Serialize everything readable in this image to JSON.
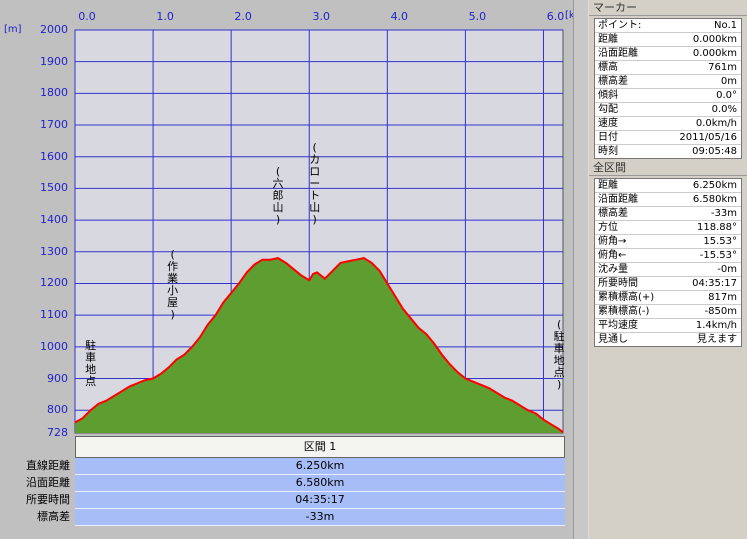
{
  "chart_data": {
    "type": "area",
    "xlabel_unit": "[km]",
    "ylabel_unit": "[m]",
    "xlim": [
      0,
      6.25
    ],
    "ylim": [
      728,
      2000
    ],
    "x_ticks": [
      "0.0",
      "1.0",
      "2.0",
      "3.0",
      "4.0",
      "5.0",
      "6.0"
    ],
    "y_ticks": [
      "2000",
      "1900",
      "1800",
      "1700",
      "1600",
      "1500",
      "1400",
      "1300",
      "1200",
      "1100",
      "1000",
      "900",
      "800",
      "728"
    ],
    "grid": true,
    "series": [
      {
        "values_x": [
          0.0,
          0.1,
          0.2,
          0.3,
          0.4,
          0.5,
          0.6,
          0.7,
          0.8,
          0.9,
          1.0,
          1.1,
          1.2,
          1.3,
          1.4,
          1.5,
          1.6,
          1.7,
          1.8,
          1.9,
          2.0,
          2.1,
          2.2,
          2.3,
          2.4,
          2.5,
          2.6,
          2.7,
          2.8,
          2.9,
          3.0,
          3.05,
          3.1,
          3.15,
          3.2,
          3.3,
          3.4,
          3.5,
          3.6,
          3.7,
          3.8,
          3.9,
          4.0,
          4.1,
          4.2,
          4.3,
          4.4,
          4.5,
          4.6,
          4.7,
          4.8,
          4.9,
          5.0,
          5.1,
          5.2,
          5.3,
          5.4,
          5.5,
          5.6,
          5.7,
          5.8,
          5.9,
          6.0,
          6.1,
          6.2,
          6.25
        ],
        "values_y": [
          761,
          775,
          800,
          820,
          830,
          845,
          860,
          875,
          885,
          895,
          900,
          915,
          935,
          960,
          975,
          1000,
          1030,
          1070,
          1100,
          1140,
          1170,
          1200,
          1235,
          1260,
          1275,
          1275,
          1280,
          1265,
          1245,
          1225,
          1210,
          1230,
          1235,
          1225,
          1215,
          1240,
          1265,
          1270,
          1275,
          1280,
          1265,
          1240,
          1200,
          1160,
          1120,
          1090,
          1060,
          1040,
          1010,
          975,
          945,
          920,
          900,
          890,
          880,
          870,
          855,
          840,
          830,
          815,
          800,
          790,
          770,
          755,
          740,
          730
        ]
      }
    ],
    "colors": {
      "fill": "#5e9e30",
      "line": "#ff0000",
      "grid": "#3333cc",
      "plot_bg": "#d8d8e0"
    },
    "annotations": [
      {
        "text": [
          "駐",
          "車",
          "地",
          "点"
        ],
        "x": 0.2,
        "y": 870
      },
      {
        "text": [
          "(",
          "作",
          "業",
          "小",
          "屋",
          ")"
        ],
        "x": 1.25,
        "y": 1080
      },
      {
        "text": [
          "(",
          "六",
          "郎",
          "山",
          ")"
        ],
        "x": 2.6,
        "y": 1380
      },
      {
        "text": [
          "(",
          "カ",
          "ロ",
          "ー",
          "ト",
          "山",
          ")"
        ],
        "x": 3.07,
        "y": 1380
      },
      {
        "text": [
          "(",
          "駐",
          "車",
          "地",
          "点",
          ")"
        ],
        "x": 6.2,
        "y": 860
      }
    ]
  },
  "section": {
    "title": "区間 1",
    "rows": [
      {
        "label": "直線距離",
        "value": "6.250km"
      },
      {
        "label": "沿面距離",
        "value": "6.580km"
      },
      {
        "label": "所要時間",
        "value": "04:35:17"
      },
      {
        "label": "標高差",
        "value": "-33m"
      }
    ]
  },
  "marker_panel": {
    "title": "マーカー",
    "rows": [
      {
        "k": "ポイント:",
        "v": "No.1"
      },
      {
        "k": "距離",
        "v": "0.000km"
      },
      {
        "k": "沿面距離",
        "v": "0.000km"
      },
      {
        "k": "標高",
        "v": "761m"
      },
      {
        "k": "標高差",
        "v": "0m"
      },
      {
        "k": "傾斜",
        "v": "0.0°"
      },
      {
        "k": "勾配",
        "v": "0.0%"
      },
      {
        "k": "速度",
        "v": "0.0km/h"
      },
      {
        "k": "日付",
        "v": "2011/05/16"
      },
      {
        "k": "時刻",
        "v": "09:05:48"
      }
    ]
  },
  "total_panel": {
    "title": "全区間",
    "rows": [
      {
        "k": "距離",
        "v": "6.250km"
      },
      {
        "k": "沿面距離",
        "v": "6.580km"
      },
      {
        "k": "標高差",
        "v": "-33m"
      },
      {
        "k": "方位",
        "v": "118.88°"
      },
      {
        "k": "俯角→",
        "v": "15.53°"
      },
      {
        "k": "俯角←",
        "v": "-15.53°"
      },
      {
        "k": "沈み量",
        "v": "-0m"
      },
      {
        "k": "所要時間",
        "v": "04:35:17"
      },
      {
        "k": "累積標高(+)",
        "v": "817m"
      },
      {
        "k": "累積標高(-)",
        "v": "-850m"
      },
      {
        "k": "平均速度",
        "v": "1.4km/h"
      },
      {
        "k": "見通し",
        "v": "見えます"
      }
    ]
  }
}
